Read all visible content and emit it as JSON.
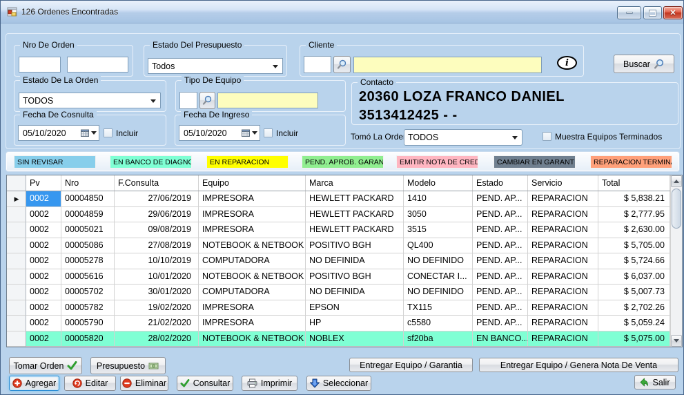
{
  "window": {
    "title": "126 Ordenes Encontradas"
  },
  "filters": {
    "nro_orden": {
      "label": "Nro De Orden",
      "value_from": "",
      "value_to": ""
    },
    "estado_presupuesto": {
      "label": "Estado Del Presupuesto",
      "value": "Todos"
    },
    "cliente": {
      "label": "Cliente",
      "code": "",
      "name": ""
    },
    "estado_orden": {
      "label": "Estado De La Orden",
      "value": "TODOS"
    },
    "tipo_equipo": {
      "label": "Tipo De Equipo",
      "code": "",
      "name": ""
    },
    "contacto": {
      "label": "Contacto",
      "line1": "20360 LOZA FRANCO DANIEL",
      "line2": "3513412425 -  -"
    },
    "fecha_consulta": {
      "label": "Fecha De Cosnulta",
      "value": "05/10/2020",
      "incluir": "Incluir",
      "checked": false
    },
    "fecha_ingreso": {
      "label": "Fecha De Ingreso",
      "value": "05/10/2020",
      "incluir": "Incluir",
      "checked": false
    },
    "tomo_orden": {
      "label": "Tomó La Orden",
      "value": "TODOS"
    },
    "muestra_terminados": {
      "label": "Muestra Equipos Terminados",
      "checked": false
    }
  },
  "buttons": {
    "buscar": "Buscar",
    "tomar_orden": "Tomar Orden",
    "presupuesto": "Presupuesto",
    "entregar_garantia": "Entregar Equipo / Garantia",
    "entregar_nota": "Entregar Equipo / Genera Nota De Venta",
    "agregar": "Agregar",
    "editar": "Editar",
    "eliminar": "Eliminar",
    "consultar": "Consultar",
    "imprimir": "Imprimir",
    "seleccionar": "Seleccionar",
    "salir": "Salir"
  },
  "legend": [
    {
      "label": "SIN REVISAR",
      "color": "#87CEEB"
    },
    {
      "label": "EN BANCO DE DIAGNOSTICO",
      "color": "#7FFFD4"
    },
    {
      "label": "EN REPARACION",
      "color": "#FFFF00"
    },
    {
      "label": "PEND. APROB. GARANTIA",
      "color": "#90EE90"
    },
    {
      "label": "EMITIR NOTA DE CREDITO",
      "color": "#FFB6C1"
    },
    {
      "label": "CAMBIAR EN GARANTIA",
      "color": "#708090"
    },
    {
      "label": "REPARACION TERMINADA",
      "color": "#FFA07A"
    }
  ],
  "grid": {
    "columns": [
      "Pv",
      "Nro",
      "F.Consulta",
      "Equipo",
      "Marca",
      "Modelo",
      "Estado",
      "Servicio",
      "Total"
    ],
    "rows": [
      {
        "pv": "0002",
        "nro": "00004850",
        "fconsulta": "27/06/2019",
        "equipo": "IMPRESORA",
        "marca": "HEWLETT PACKARD",
        "modelo": "1410",
        "estado": "PEND. AP...",
        "servicio": "REPARACION",
        "total": "$ 5,838.21",
        "selected": true
      },
      {
        "pv": "0002",
        "nro": "00004859",
        "fconsulta": "29/06/2019",
        "equipo": "IMPRESORA",
        "marca": "HEWLETT PACKARD",
        "modelo": "3050",
        "estado": "PEND. AP...",
        "servicio": "REPARACION",
        "total": "$ 2,777.95"
      },
      {
        "pv": "0002",
        "nro": "00005021",
        "fconsulta": "09/08/2019",
        "equipo": "IMPRESORA",
        "marca": "HEWLETT PACKARD",
        "modelo": "3515",
        "estado": "PEND. AP...",
        "servicio": "REPARACION",
        "total": "$ 2,630.00"
      },
      {
        "pv": "0002",
        "nro": "00005086",
        "fconsulta": "27/08/2019",
        "equipo": "NOTEBOOK & NETBOOK",
        "marca": "POSITIVO BGH",
        "modelo": "QL400",
        "estado": "PEND. AP...",
        "servicio": "REPARACION",
        "total": "$ 5,705.00"
      },
      {
        "pv": "0002",
        "nro": "00005278",
        "fconsulta": "10/10/2019",
        "equipo": "COMPUTADORA",
        "marca": "NO DEFINIDA",
        "modelo": "NO DEFINIDO",
        "estado": "PEND. AP...",
        "servicio": "REPARACION",
        "total": "$ 5,724.66"
      },
      {
        "pv": "0002",
        "nro": "00005616",
        "fconsulta": "10/01/2020",
        "equipo": "NOTEBOOK & NETBOOK",
        "marca": "POSITIVO BGH",
        "modelo": "CONECTAR I...",
        "estado": "PEND. AP...",
        "servicio": "REPARACION",
        "total": "$ 6,037.00"
      },
      {
        "pv": "0002",
        "nro": "00005702",
        "fconsulta": "30/01/2020",
        "equipo": "COMPUTADORA",
        "marca": "NO DEFINIDA",
        "modelo": "NO DEFINIDO",
        "estado": "PEND. AP...",
        "servicio": "REPARACION",
        "total": "$ 5,007.73"
      },
      {
        "pv": "0002",
        "nro": "00005782",
        "fconsulta": "19/02/2020",
        "equipo": "IMPRESORA",
        "marca": "EPSON",
        "modelo": "TX115",
        "estado": "PEND. AP...",
        "servicio": "REPARACION",
        "total": "$ 2,702.26"
      },
      {
        "pv": "0002",
        "nro": "00005790",
        "fconsulta": "21/02/2020",
        "equipo": "IMPRESORA",
        "marca": "HP",
        "modelo": "c5580",
        "estado": "PEND. AP...",
        "servicio": "REPARACION",
        "total": "$ 5,059.24"
      },
      {
        "pv": "0002",
        "nro": "00005820",
        "fconsulta": "28/02/2020",
        "equipo": "NOTEBOOK & NETBOOK",
        "marca": "NOBLEX",
        "modelo": "sf20ba",
        "estado": "EN BANCO...",
        "servicio": "REPARACION",
        "total": "$ 5,075.00",
        "highlight": "#7FFFD4"
      }
    ]
  },
  "colors": {
    "form_bg": "#b9d3ec",
    "field_info": "#fdfdbe",
    "selection": "#3797ef"
  }
}
